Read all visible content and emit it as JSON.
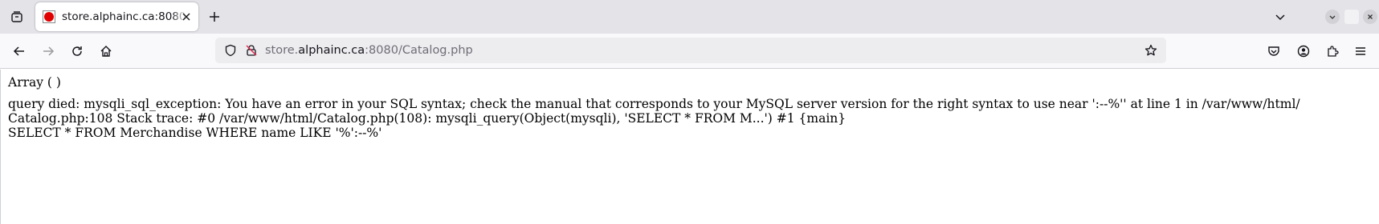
{
  "browser": {
    "tab": {
      "title": "store.alphainc.ca:8080/Catalog.php"
    },
    "address_bar": {
      "url_host_prefix": "store.",
      "url_domain": "alphainc.ca",
      "url_rest": ":8080/Catalog.php"
    },
    "icons": {
      "tab_list": "tab-list-icon",
      "close_tab": "close-icon",
      "new_tab": "plus-icon",
      "back": "back-arrow-icon",
      "forward": "forward-arrow-icon",
      "reload": "reload-icon",
      "home": "home-icon",
      "tracking_protection": "shield-icon",
      "insecure_lock": "lock-strike-icon",
      "bookmark": "star-icon",
      "pocket": "pocket-icon",
      "account": "account-icon",
      "extensions": "puzzle-icon",
      "menu": "hamburger-menu-icon"
    }
  },
  "page": {
    "line1": "Array ( )",
    "line2": "query died: mysqli_sql_exception: You have an error in your SQL syntax; check the manual that corresponds to your MySQL server version for the right syntax to use near ':--%'' at line 1 in /var/www/html/",
    "line3": "Catalog.php:108 Stack trace: #0 /var/www/html/Catalog.php(108): mysqli_query(Object(mysqli), 'SELECT * FROM M...') #1 {main}",
    "line4": "SELECT * FROM Merchandise WHERE name LIKE '%':--%'"
  }
}
